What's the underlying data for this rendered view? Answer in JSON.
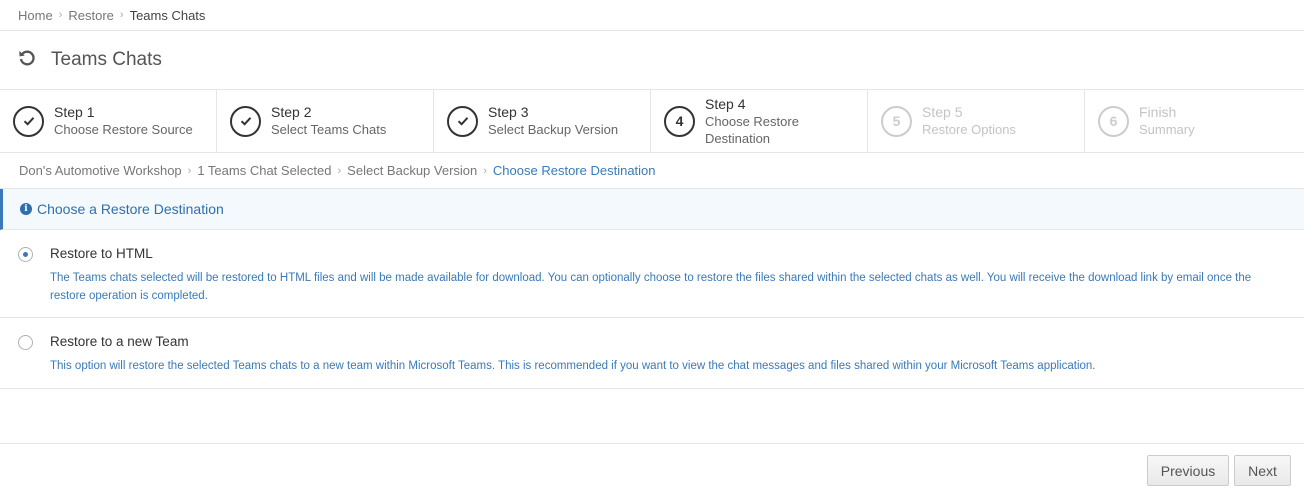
{
  "breadcrumb": {
    "items": [
      "Home",
      "Restore",
      "Teams Chats"
    ]
  },
  "header": {
    "title": "Teams Chats",
    "icon": "restore-icon"
  },
  "steps": [
    {
      "label": "Step 1",
      "desc": "Choose Restore Source",
      "state": "done"
    },
    {
      "label": "Step 2",
      "desc": "Select Teams Chats",
      "state": "done"
    },
    {
      "label": "Step 3",
      "desc": "Select Backup Version",
      "state": "done"
    },
    {
      "label": "Step 4",
      "desc": "Choose Restore Destination",
      "state": "current",
      "number": "4"
    },
    {
      "label": "Step 5",
      "desc": "Restore Options",
      "state": "pending",
      "number": "5"
    },
    {
      "label": "Finish",
      "desc": "Summary",
      "state": "pending",
      "number": "6"
    }
  ],
  "sub_breadcrumb": {
    "items": [
      "Don's Automotive Workshop",
      "1 Teams Chat Selected",
      "Select Backup Version",
      "Choose Restore Destination"
    ]
  },
  "info": {
    "text": "Choose a Restore Destination"
  },
  "options": [
    {
      "title": "Restore to HTML",
      "desc": "The Teams chats selected will be restored to HTML files and will be made available for download. You can optionally choose to restore the files shared within the selected chats as well. You will receive the download link by email once the restore operation is completed.",
      "selected": true
    },
    {
      "title": "Restore to a new Team",
      "desc": "This option will restore the selected Teams chats to a new team within Microsoft Teams. This is recommended if you want to view the chat messages and files shared within your Microsoft Teams application.",
      "selected": false
    }
  ],
  "footer": {
    "previous_label": "Previous",
    "next_label": "Next"
  },
  "colors": {
    "accent": "#3a7ab8",
    "info_bg": "#f4f9fd"
  }
}
